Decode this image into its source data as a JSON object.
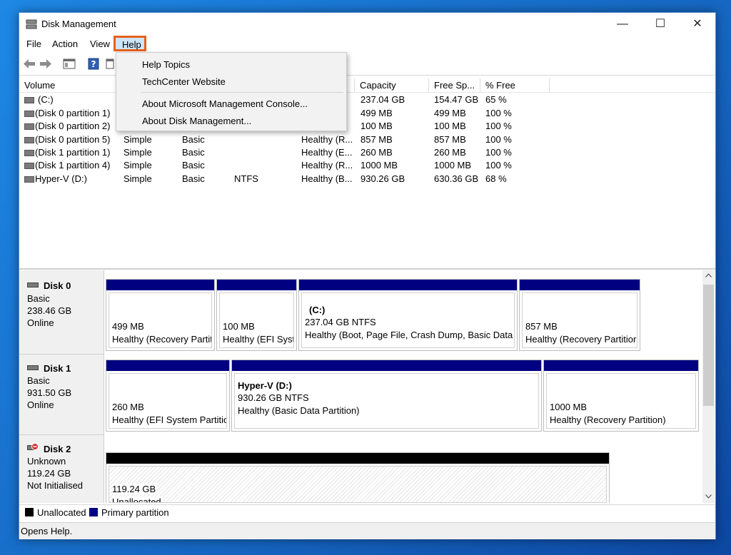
{
  "window": {
    "title": "Disk Management",
    "minimize": "—",
    "maximize": "☐",
    "close": "✕"
  },
  "menu": {
    "file": "File",
    "action": "Action",
    "view": "View",
    "help": "Help"
  },
  "help_menu": [
    "Help Topics",
    "TechCenter Website",
    "About Microsoft Management Console...",
    "About Disk Management..."
  ],
  "columns": [
    "Volume",
    "Capacity",
    "Free Sp...",
    "% Free"
  ],
  "volumes": [
    {
      "volume": "(C:)",
      "layout": "",
      "type": "",
      "fs": "",
      "status": "",
      "capacity": "237.04 GB",
      "free": "154.47 GB",
      "pct": "65 %"
    },
    {
      "volume": "(Disk 0 partition 1)",
      "layout": "",
      "type": "",
      "fs": "",
      "status": "",
      "capacity": "499 MB",
      "free": "499 MB",
      "pct": "100 %"
    },
    {
      "volume": "(Disk 0 partition 2)",
      "layout": "",
      "type": "",
      "fs": "",
      "status": "",
      "capacity": "100 MB",
      "free": "100 MB",
      "pct": "100 %"
    },
    {
      "volume": "(Disk 0 partition 5)",
      "layout": "Simple",
      "type": "Basic",
      "fs": "",
      "status": "Healthy (R...",
      "capacity": "857 MB",
      "free": "857 MB",
      "pct": "100 %"
    },
    {
      "volume": "(Disk 1 partition 1)",
      "layout": "Simple",
      "type": "Basic",
      "fs": "",
      "status": "Healthy (E...",
      "capacity": "260 MB",
      "free": "260 MB",
      "pct": "100 %"
    },
    {
      "volume": "(Disk 1 partition 4)",
      "layout": "Simple",
      "type": "Basic",
      "fs": "",
      "status": "Healthy (R...",
      "capacity": "1000 MB",
      "free": "1000 MB",
      "pct": "100 %"
    },
    {
      "volume": "Hyper-V (D:)",
      "layout": "Simple",
      "type": "Basic",
      "fs": "NTFS",
      "status": "Healthy (B...",
      "capacity": "930.26 GB",
      "free": "630.36 GB",
      "pct": "68 %"
    }
  ],
  "disks": [
    {
      "name": "Disk 0",
      "type": "Basic",
      "size": "238.46 GB",
      "state": "Online",
      "partitions": [
        {
          "title": "",
          "size": "499 MB",
          "status": "Healthy (Recovery Partit"
        },
        {
          "title": "",
          "size": "100 MB",
          "status": "Healthy (EFI Syste"
        },
        {
          "title": "(C:)",
          "size": "237.04 GB NTFS",
          "status": "Healthy (Boot, Page File, Crash Dump, Basic Data Pa"
        },
        {
          "title": "",
          "size": "857 MB",
          "status": "Healthy (Recovery Partitior"
        }
      ]
    },
    {
      "name": "Disk 1",
      "type": "Basic",
      "size": "931.50 GB",
      "state": "Online",
      "partitions": [
        {
          "title": "",
          "size": "260 MB",
          "status": "Healthy (EFI System Partitio"
        },
        {
          "title": "Hyper-V  (D:)",
          "size": "930.26 GB NTFS",
          "status": "Healthy (Basic Data Partition)"
        },
        {
          "title": "",
          "size": "1000 MB",
          "status": "Healthy (Recovery Partition)"
        }
      ]
    },
    {
      "name": "Disk 2",
      "type": "Unknown",
      "size": "119.24 GB",
      "state": "Not Initialised",
      "partitions": [
        {
          "title": "",
          "size": "119.24 GB",
          "status": "Unallocated"
        }
      ]
    }
  ],
  "legend": {
    "unallocated": "Unallocated",
    "primary": "Primary partition",
    "unallocated_color": "#000000",
    "primary_color": "#000080"
  },
  "status_bar": "Opens Help."
}
